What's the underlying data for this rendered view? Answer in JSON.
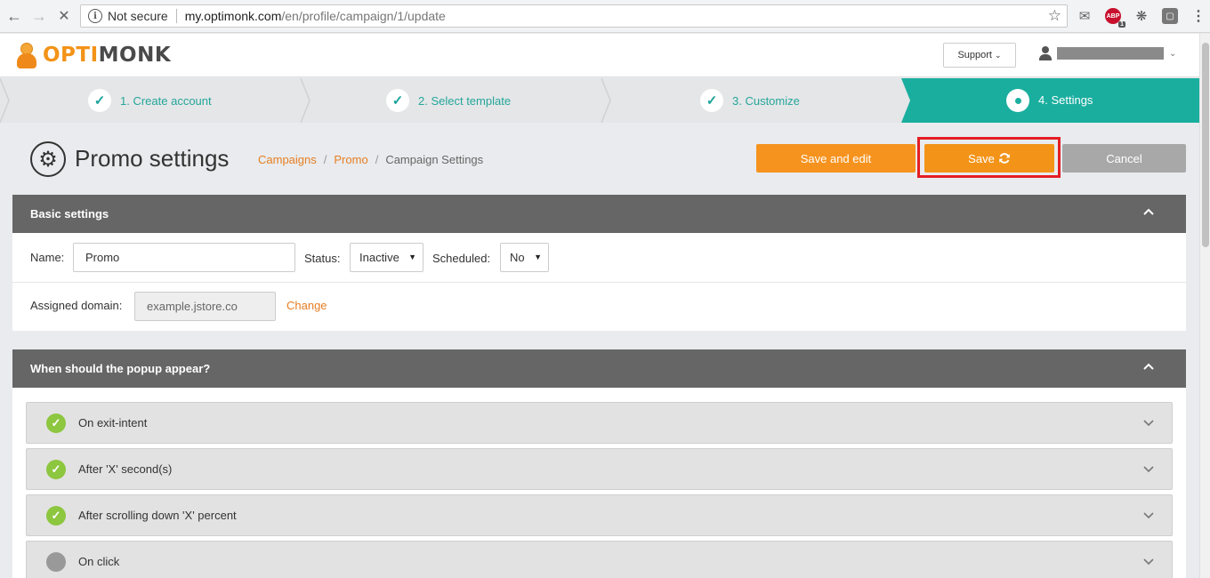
{
  "browser": {
    "security_label": "Not secure",
    "url_host": "my.optimonk.com",
    "url_path": "/en/profile/campaign/1/update"
  },
  "header": {
    "logo_part1": "OPTI",
    "logo_part2": "MONK",
    "support_label": "Support"
  },
  "steps": [
    {
      "label": "1. Create account",
      "state": "done"
    },
    {
      "label": "2. Select template",
      "state": "done"
    },
    {
      "label": "3. Customize",
      "state": "done"
    },
    {
      "label": "4. Settings",
      "state": "active"
    }
  ],
  "page": {
    "title": "Promo settings",
    "breadcrumb": [
      "Campaigns",
      "Promo",
      "Campaign Settings"
    ],
    "save_edit_label": "Save and edit",
    "save_label": "Save",
    "cancel_label": "Cancel"
  },
  "basic_settings": {
    "heading": "Basic settings",
    "name_label": "Name:",
    "name_value": "Promo",
    "status_label": "Status:",
    "status_value": "Inactive",
    "scheduled_label": "Scheduled:",
    "scheduled_value": "No",
    "domain_label": "Assigned domain:",
    "domain_value": "example.jstore.co",
    "change_label": "Change"
  },
  "popup_section": {
    "heading": "When should the popup appear?",
    "triggers": [
      {
        "label": "On exit-intent",
        "enabled": true
      },
      {
        "label": "After 'X' second(s)",
        "enabled": true
      },
      {
        "label": "After scrolling down 'X' percent",
        "enabled": true
      },
      {
        "label": "On click",
        "enabled": false
      }
    ]
  },
  "colors": {
    "accent_orange": "#f6931f",
    "teal": "#1aae9f",
    "panel_gray": "#666666",
    "check_green": "#8dc63f",
    "highlight_red": "#e31e24"
  }
}
